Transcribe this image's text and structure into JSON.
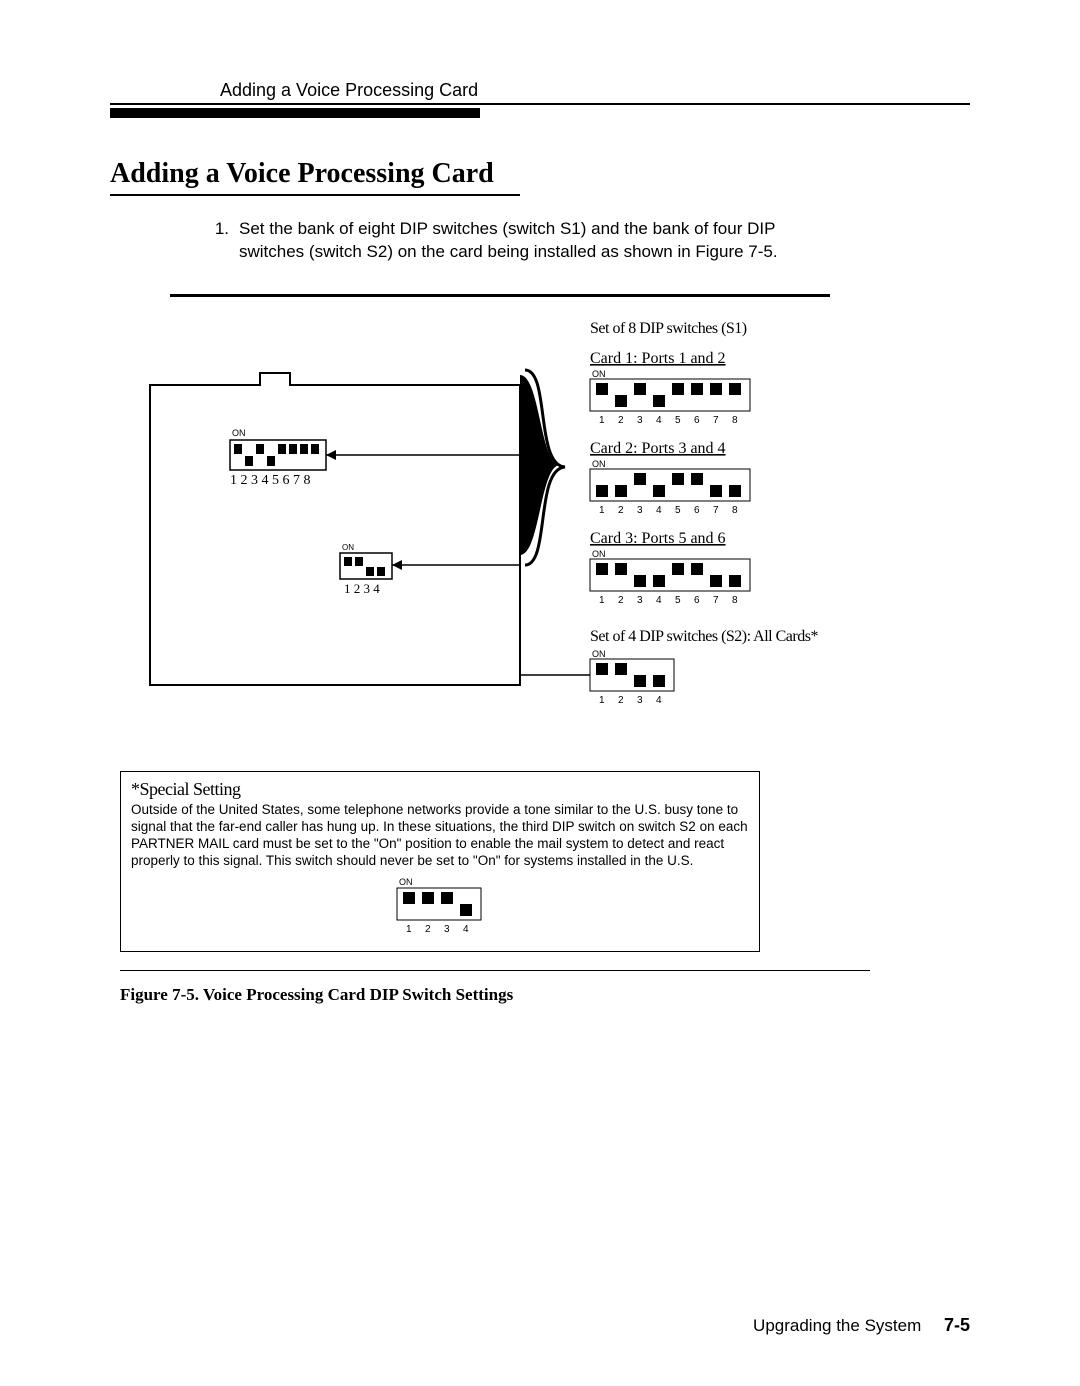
{
  "running_head": "Adding a Voice Processing Card",
  "section_title": "Adding a Voice Processing Card",
  "step": {
    "num": "1.",
    "text": "Set the bank of eight DIP switches (switch S1) and the bank of four DIP switches (switch S2) on the card being installed as shown in Figure 7-5."
  },
  "fig": {
    "set_s1_title": "Set of 8 DIP switches (S1)",
    "card1": "Card 1: Ports 1 and 2",
    "card2": "Card 2: Ports 3 and 4",
    "card3": "Card 3: Ports 5 and 6",
    "set_s2_title": "Set of 4 DIP switches (S2): All Cards*",
    "s1_numbers": "1 2 3 4 5 6 7 8",
    "s2_numbers": "1 2 3 4",
    "on": "ON"
  },
  "special": {
    "title": "*Special Setting",
    "body": "Outside of the United States, some telephone networks provide a tone similar to the U.S. busy tone to signal that the far-end caller has hung up. In these situations, the third DIP switch on switch S2 on each PARTNER MAIL card must be set to the \"On\" position to enable the mail system to detect and react properly to this signal. This switch should never be set to \"On\" for systems installed in the U.S.",
    "dip_numbers": "1 2 3 4"
  },
  "figure_label": "Figure 7-5. Voice Processing Card DIP Switch Settings",
  "footer": {
    "text": "Upgrading the System",
    "page": "7-5"
  }
}
